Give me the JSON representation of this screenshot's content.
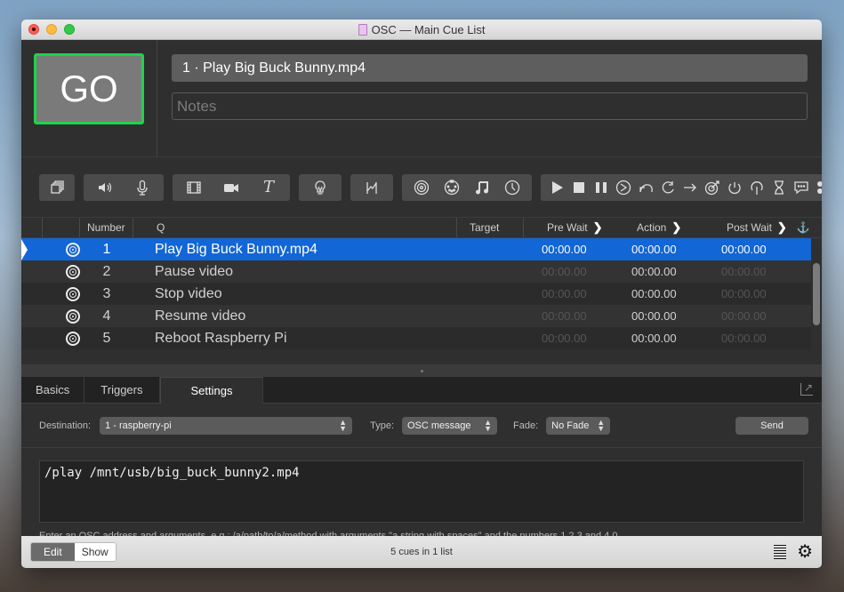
{
  "window": {
    "title": "OSC — Main Cue List"
  },
  "go": {
    "label": "GO"
  },
  "cue_info": {
    "name": "1 · Play Big Buck Bunny.mp4",
    "notes_placeholder": "Notes"
  },
  "toolbar": {
    "groups": [
      [
        "group-icon"
      ],
      [
        "audio-icon",
        "mic-icon"
      ],
      [
        "video-icon",
        "camera-icon",
        "text-icon"
      ],
      [
        "light-icon"
      ],
      [
        "fade-icon"
      ],
      [
        "network-icon",
        "midi-icon",
        "music-icon",
        "timecode-icon"
      ],
      [
        "start-icon",
        "stop-icon",
        "pause-icon",
        "load-icon",
        "reset-icon",
        "devamp-icon",
        "goto-icon",
        "target-icon",
        "arm-icon",
        "disarm-icon",
        "wait-icon",
        "memo-icon",
        "script-icon"
      ]
    ]
  },
  "table": {
    "headers": {
      "number": "Number",
      "q": "Q",
      "target": "Target",
      "pre_wait": "Pre Wait",
      "action": "Action",
      "post_wait": "Post Wait"
    },
    "rows": [
      {
        "number": "1",
        "q": "Play Big Buck Bunny.mp4",
        "target": "",
        "pre_wait": "00:00.00",
        "action": "00:00.00",
        "post_wait": "00:00.00",
        "selected": true
      },
      {
        "number": "2",
        "q": "Pause video",
        "target": "",
        "pre_wait": "00:00.00",
        "action": "00:00.00",
        "post_wait": "00:00.00"
      },
      {
        "number": "3",
        "q": "Stop video",
        "target": "",
        "pre_wait": "00:00.00",
        "action": "00:00.00",
        "post_wait": "00:00.00"
      },
      {
        "number": "4",
        "q": "Resume video",
        "target": "",
        "pre_wait": "00:00.00",
        "action": "00:00.00",
        "post_wait": "00:00.00"
      },
      {
        "number": "5",
        "q": "Reboot Raspberry Pi",
        "target": "",
        "pre_wait": "00:00.00",
        "action": "00:00.00",
        "post_wait": "00:00.00"
      }
    ]
  },
  "inspector": {
    "tabs": [
      "Basics",
      "Triggers",
      "Settings"
    ],
    "active_tab": "Settings",
    "destination_label": "Destination:",
    "destination_value": "1 - raspberry-pi",
    "type_label": "Type:",
    "type_value": "OSC message",
    "fade_label": "Fade:",
    "fade_value": "No Fade",
    "send_label": "Send",
    "message": "/play /mnt/usb/big_buck_bunny2.mp4",
    "hint": "Enter an OSC address and arguments, e.g.: /a/path/to/a/method with arguments \"a string with spaces\" and the numbers 1 2 3 and 4.0"
  },
  "statusbar": {
    "edit_label": "Edit",
    "show_label": "Show",
    "status": "5 cues in 1 list"
  },
  "colors": {
    "go_border": "#1fd34a",
    "selection": "#1266d6"
  }
}
